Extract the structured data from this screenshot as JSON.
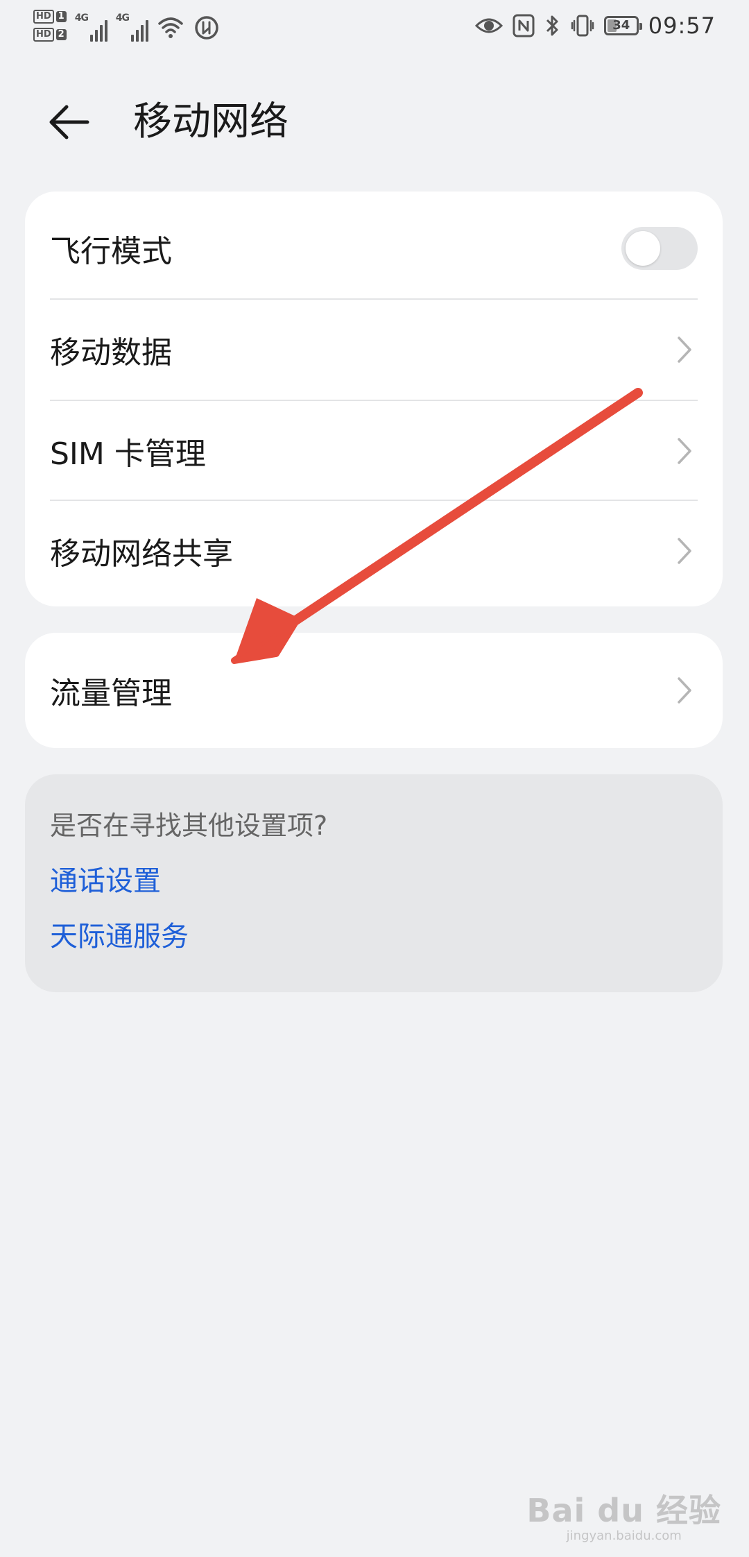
{
  "status_bar": {
    "sim1_badge": "HD",
    "sim1_num": "1",
    "sim2_badge": "HD",
    "sim2_num": "2",
    "network1": "4G",
    "network2": "4G",
    "battery_level_pct": 34,
    "battery_text": "34",
    "time": "09:57",
    "icons": [
      "eye-icon",
      "nfc-icon",
      "bluetooth-icon",
      "vibrate-icon",
      "battery-icon"
    ]
  },
  "header": {
    "back_icon": "arrow-left-icon",
    "title": "移动网络"
  },
  "settings_main": {
    "items": [
      {
        "label": "飞行模式",
        "control": "toggle",
        "state": "off"
      },
      {
        "label": "移动数据",
        "control": "chevron"
      },
      {
        "label": "SIM 卡管理",
        "control": "chevron"
      },
      {
        "label": "移动网络共享",
        "control": "chevron"
      }
    ]
  },
  "settings_traffic": {
    "items": [
      {
        "label": "流量管理",
        "control": "chevron"
      }
    ]
  },
  "suggestions": {
    "title": "是否在寻找其他设置项?",
    "links": [
      "通话设置",
      "天际通服务"
    ]
  },
  "colors": {
    "background": "#f1f2f4",
    "card": "#ffffff",
    "suggestion_card": "#e6e7e9",
    "link": "#1e5fd8",
    "annotation_arrow": "#e74c3c"
  },
  "watermark": {
    "main": "Bai du 经验",
    "sub": "jingyan.baidu.com"
  }
}
